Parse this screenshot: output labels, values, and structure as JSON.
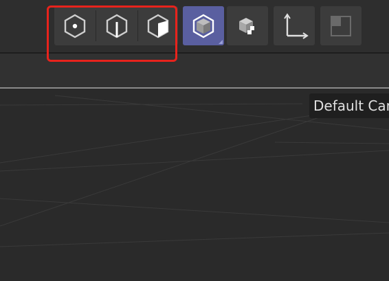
{
  "toolbar": {
    "tools": [
      {
        "name": "point-mode",
        "icon": "hexagon-point-icon",
        "active": false
      },
      {
        "name": "edge-mode",
        "icon": "hexagon-edge-icon",
        "active": false
      },
      {
        "name": "polygon-mode",
        "icon": "hexagon-face-icon",
        "active": false
      },
      {
        "name": "model-mode",
        "icon": "cube-model-icon",
        "active": true
      },
      {
        "name": "texture-mode",
        "icon": "cube-texture-icon",
        "active": false
      },
      {
        "name": "axis-mode",
        "icon": "axis-corner-icon",
        "active": false
      },
      {
        "name": "workplane-mode",
        "icon": "square-workplane-icon",
        "active": false
      }
    ],
    "highlight_color": "#e8231c",
    "active_color": "#5a5fa0"
  },
  "viewport": {
    "camera_label": "Default Camera"
  }
}
